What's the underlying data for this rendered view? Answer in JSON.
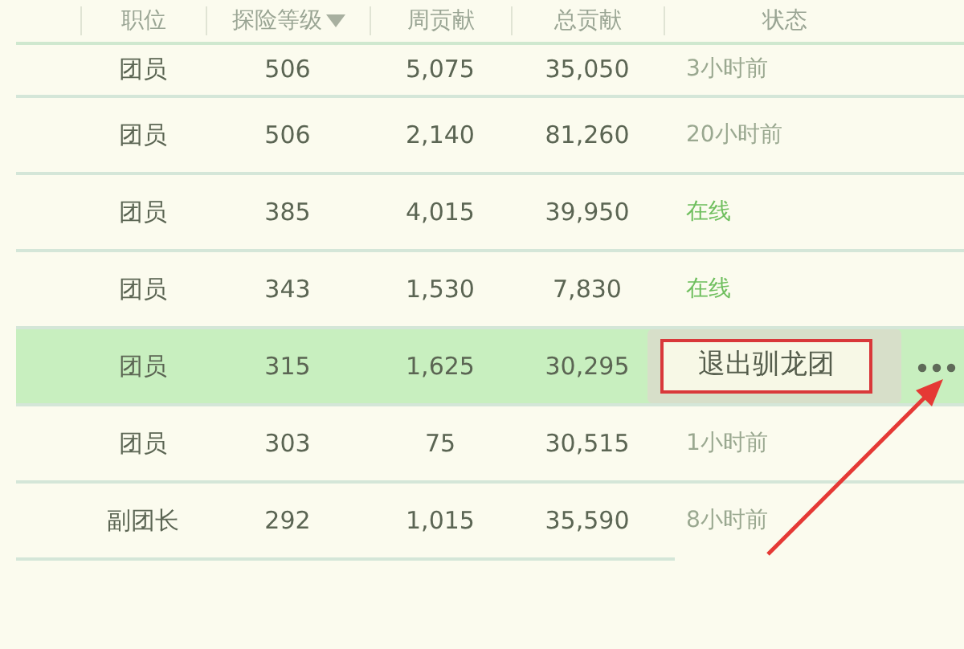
{
  "columns": [
    {
      "label": "职位"
    },
    {
      "label": "探险等级",
      "sorted": true
    },
    {
      "label": "周贡献"
    },
    {
      "label": "总贡献"
    },
    {
      "label": "状态"
    }
  ],
  "rows": [
    {
      "role": "团员",
      "level": "506",
      "weekly": "5,075",
      "total": "35,050",
      "status": "3小时前",
      "online": false,
      "selected": false
    },
    {
      "role": "团员",
      "level": "506",
      "weekly": "2,140",
      "total": "81,260",
      "status": "20小时前",
      "online": false,
      "selected": false
    },
    {
      "role": "团员",
      "level": "385",
      "weekly": "4,015",
      "total": "39,950",
      "status": "在线",
      "online": true,
      "selected": false
    },
    {
      "role": "团员",
      "level": "343",
      "weekly": "1,530",
      "total": "7,830",
      "status": "在线",
      "online": true,
      "selected": false
    },
    {
      "role": "团员",
      "level": "315",
      "weekly": "1,625",
      "total": "30,295",
      "selected": true,
      "menu_action": "退出驯龙团"
    },
    {
      "role": "团员",
      "level": "303",
      "weekly": "75",
      "total": "30,515",
      "status": "1小时前",
      "online": false,
      "selected": false
    },
    {
      "role": "副团长",
      "level": "292",
      "weekly": "1,015",
      "total": "35,590",
      "status": "8小时前",
      "online": false,
      "selected": false
    }
  ]
}
